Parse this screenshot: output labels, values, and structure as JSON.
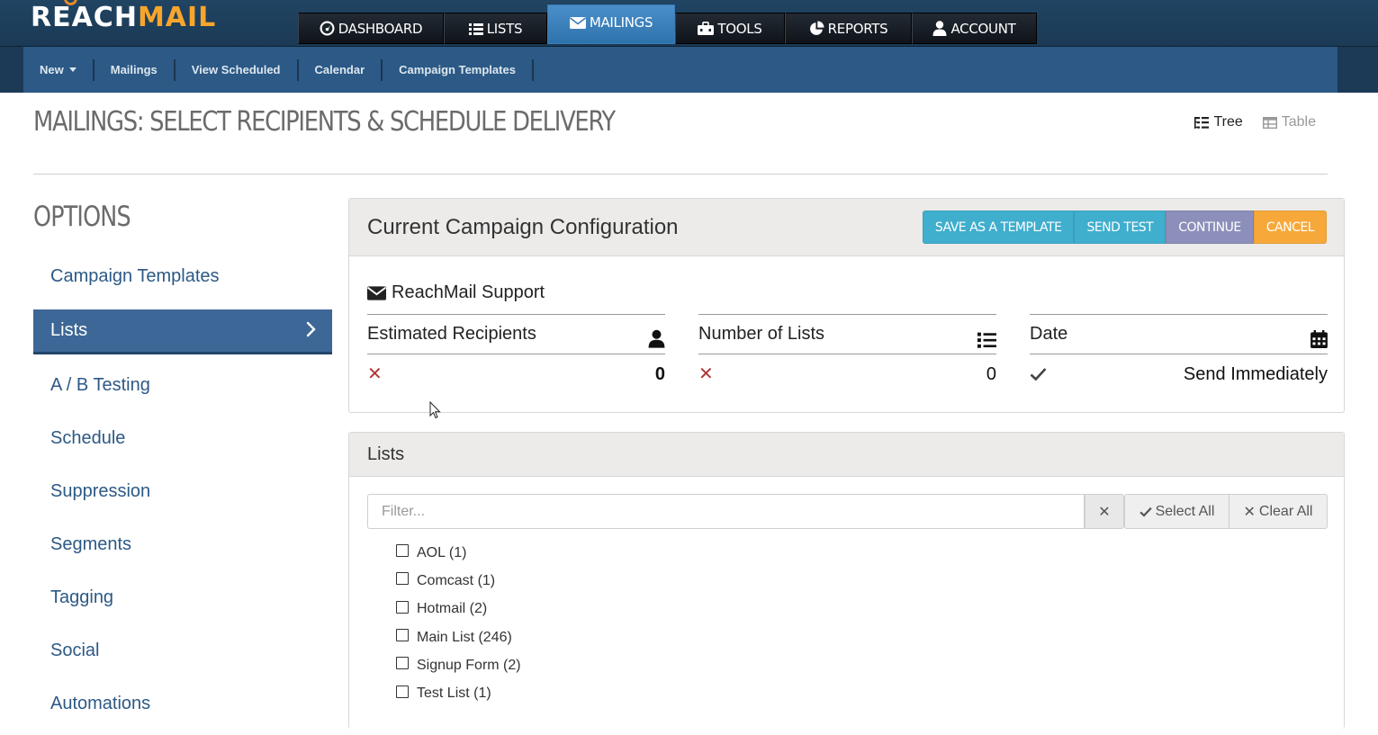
{
  "app": {
    "logo_reach": "REACH",
    "logo_mail": "MAIL"
  },
  "main_nav": [
    {
      "label": "DASHBOARD",
      "icon": "dashboard-icon"
    },
    {
      "label": "LISTS",
      "icon": "list-icon"
    },
    {
      "label": "MAILINGS",
      "icon": "envelope-icon",
      "active": true
    },
    {
      "label": "TOOLS",
      "icon": "toolbox-icon"
    },
    {
      "label": "REPORTS",
      "icon": "pie-chart-icon"
    },
    {
      "label": "ACCOUNT",
      "icon": "user-icon"
    }
  ],
  "sub_nav": {
    "new": "New",
    "mailings": "Mailings",
    "view_scheduled": "View Scheduled",
    "calendar": "Calendar",
    "campaign_templates": "Campaign Templates"
  },
  "page": {
    "title": "MAILINGS: SELECT RECIPIENTS & SCHEDULE DELIVERY",
    "view_tree": "Tree",
    "view_table": "Table"
  },
  "sidebar": {
    "title": "OPTIONS",
    "items": [
      {
        "label": "Campaign Templates"
      },
      {
        "label": "Lists",
        "active": true
      },
      {
        "label": "A / B Testing"
      },
      {
        "label": "Schedule"
      },
      {
        "label": "Suppression"
      },
      {
        "label": "Segments"
      },
      {
        "label": "Tagging"
      },
      {
        "label": "Social"
      },
      {
        "label": "Automations"
      }
    ]
  },
  "config": {
    "title": "Current Campaign Configuration",
    "buttons": {
      "save_template": "SAVE AS A TEMPLATE",
      "send_test": "SEND TEST",
      "continue": "CONTINUE",
      "cancel": "CANCEL"
    },
    "sender": "ReachMail Support",
    "stats": {
      "recipients": {
        "label": "Estimated Recipients",
        "value": "0",
        "status": "invalid"
      },
      "lists": {
        "label": "Number of Lists",
        "value": "0",
        "status": "invalid"
      },
      "date": {
        "label": "Date",
        "value": "Send Immediately",
        "status": "valid"
      }
    }
  },
  "lists_panel": {
    "title": "Lists",
    "filter_placeholder": "Filter...",
    "select_all": "Select All",
    "clear_all": "Clear All",
    "items": [
      {
        "label": "AOL (1)",
        "checked": false
      },
      {
        "label": "Comcast (1)",
        "checked": false
      },
      {
        "label": "Hotmail (2)",
        "checked": false
      },
      {
        "label": "Main List (246)",
        "checked": false
      },
      {
        "label": "Signup Form (2)",
        "checked": false
      },
      {
        "label": "Test List (1)",
        "checked": false
      }
    ]
  },
  "colors": {
    "topbar": "#1b3a56",
    "subbar": "#2c5985",
    "active_tab": "#3a7cb7",
    "sidebar_active": "#3d6796",
    "btn_info": "#40aecd",
    "btn_continue": "#8b8fb9",
    "btn_cancel": "#f6a93a",
    "invalid_mark": "#b03636"
  }
}
